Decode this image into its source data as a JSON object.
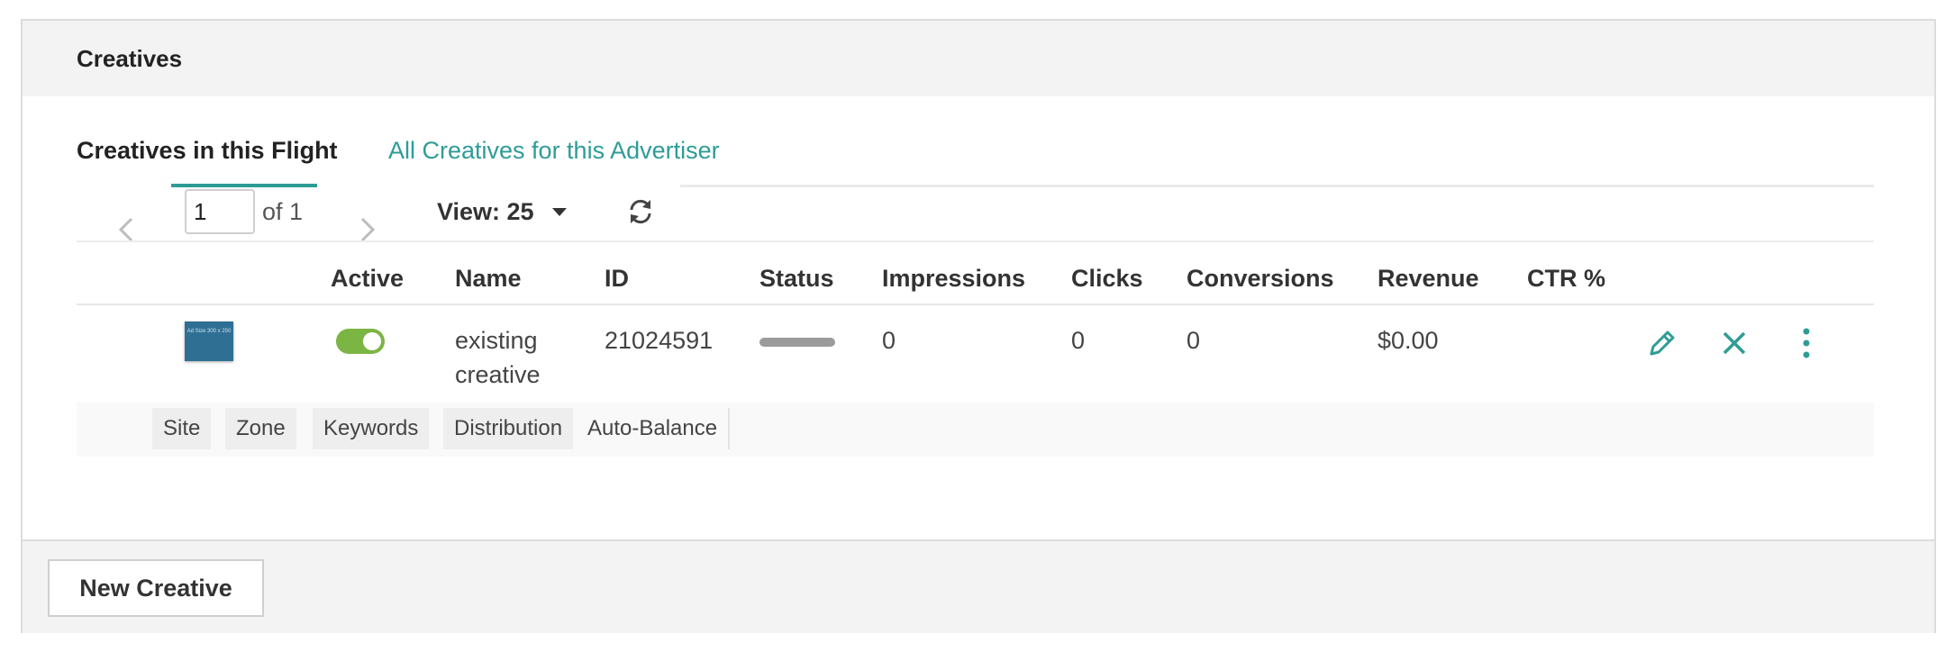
{
  "panel": {
    "title": "Creatives"
  },
  "tabs": [
    {
      "label": "Creatives in this Flight",
      "active": true
    },
    {
      "label": "All Creatives for this Advertiser",
      "active": false
    }
  ],
  "pagination": {
    "page": "1",
    "of_label": "of 1",
    "view_label": "View: 25"
  },
  "icons": {
    "prev": "chevron-left-icon",
    "next": "chevron-right-icon",
    "view": "caret-down-icon",
    "refresh": "refresh-icon",
    "edit": "pencil-icon",
    "delete": "close-icon",
    "more": "more-vertical-icon"
  },
  "colors": {
    "accent": "#2e9c96",
    "toggle_on": "#7bb543",
    "thumb": "#2f6f94"
  },
  "table": {
    "columns": [
      "Active",
      "Name",
      "ID",
      "Status",
      "Impressions",
      "Clicks",
      "Conversions",
      "Revenue",
      "CTR %"
    ],
    "rows": [
      {
        "thumbnail_text": "Ad Size 300 x 250",
        "active": true,
        "name_line1": "existing",
        "name_line2": "creative",
        "id": "21024591",
        "impressions": "0",
        "clicks": "0",
        "conversions": "0",
        "revenue": "$0.00",
        "ctr": ""
      }
    ]
  },
  "targeting": {
    "chips": [
      "Site",
      "Zone",
      "Keywords",
      "Distribution",
      "Auto-Balance"
    ]
  },
  "footer": {
    "new_creative_label": "New Creative"
  }
}
